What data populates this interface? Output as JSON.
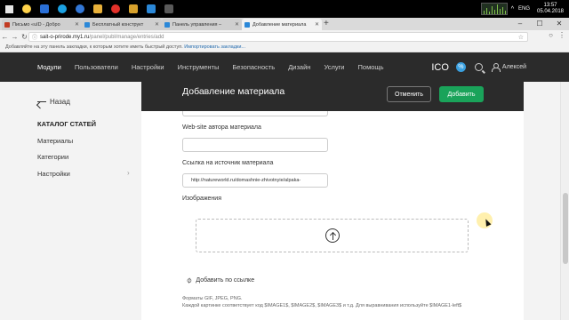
{
  "taskbar": {
    "clock_time": "13:57",
    "clock_date": "05.04.2018",
    "lang": "ENG",
    "app_colors": [
      "#ffd24a",
      "#2a6fd6",
      "#1ba1e2",
      "#3277d7",
      "#e9b13a",
      "#e3312a",
      "#d7a12c",
      "#2b88d8",
      "#5a5a5a"
    ]
  },
  "browser": {
    "tabs": [
      {
        "label": "Письмо «uID - Добро",
        "favicon_color": "#c23b22"
      },
      {
        "label": "Бесплатный конструкт",
        "favicon_color": "#2b88d8"
      },
      {
        "label": "Панель управления –",
        "favicon_color": "#2b88d8"
      },
      {
        "label": "Добавление материала",
        "favicon_color": "#2b88d8"
      }
    ],
    "url_host": "sait-o-prirode.my1.ru",
    "url_path": "/panel/publ/manage/entries/add",
    "bookmarks_hint": "Добавляйте на эту панель закладки, к которым хотите иметь быстрый доступ.",
    "bookmarks_link": "Импортировать закладки..."
  },
  "topnav": {
    "items": [
      "Модули",
      "Пользователи",
      "Настройки",
      "Инструменты",
      "Безопасность",
      "Дизайн",
      "Услуги",
      "Помощь"
    ],
    "logo": "ICO",
    "percent_badge": "%",
    "user_name": "Алексей"
  },
  "sidebar": {
    "back_label": "Назад",
    "section_title": "КАТАЛОГ СТАТЕЙ",
    "items": [
      {
        "label": "Материалы"
      },
      {
        "label": "Категории"
      },
      {
        "label": "Настройки"
      }
    ]
  },
  "main": {
    "title": "Добавление материала",
    "cancel_label": "Отменить",
    "add_label": "Добавить",
    "fields": {
      "author_site_label": "Web-site автора материала",
      "author_site_value": "",
      "source_link_label": "Ссылка на источник материала",
      "source_link_value": "http://natureworld.ru/domashnie-zhivotnyie/alpaka-",
      "images_label": "Изображения"
    },
    "add_by_link": "Добавить по ссылке",
    "hint_formats": "Форматы GIF, JPEG, PNG.",
    "hint_code": "Каждой картинке соответствует код $IMAGE1$, $IMAGE2$, $IMAGE3$ и т.д. Для выравнивания используйте $IMAGE1-left$"
  }
}
